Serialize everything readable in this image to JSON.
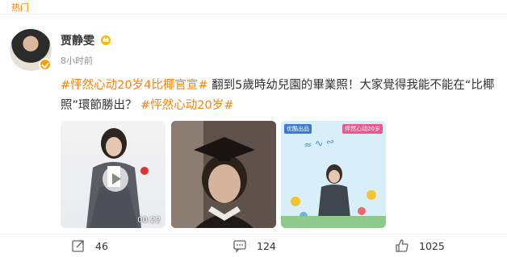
{
  "topbar": {
    "label": "热门"
  },
  "post": {
    "username": "贾静雯",
    "timestamp": "8小时前",
    "topic1": "#怦然心动20岁4比椰官宣#",
    "text1": " 翻到5歲時幼兒園的畢業照！大家覺得我能不能在“比椰照”環節勝出？ ",
    "topic2": "#怦然心动20岁#"
  },
  "media": {
    "video_duration": "00:22",
    "poster_badge_left": "优酷出品",
    "poster_badge_right": "怦然心动20岁"
  },
  "actions": {
    "share_count": "46",
    "comment_count": "124",
    "like_count": "1025"
  },
  "colors": {
    "topic": "#ff8200",
    "muted": "#939393",
    "verified": "#ff9d00"
  }
}
